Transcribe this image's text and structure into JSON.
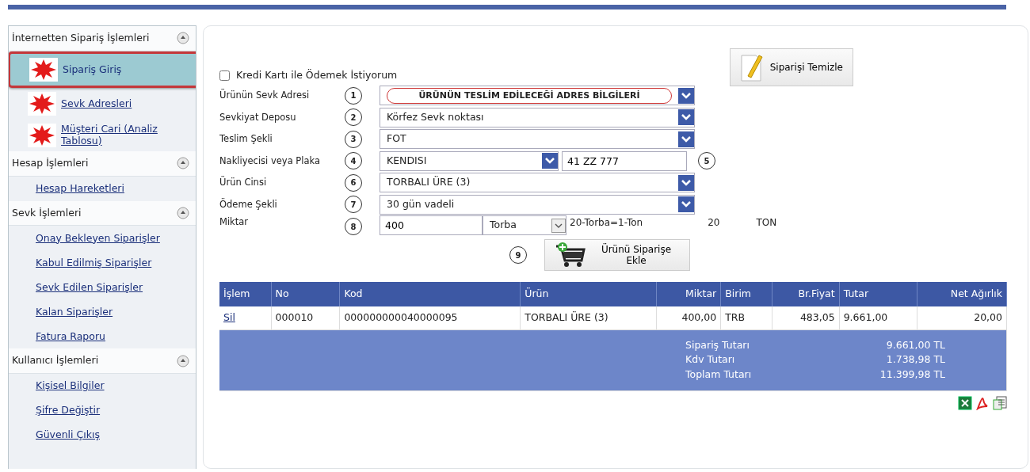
{
  "sidebar": {
    "groups": [
      {
        "title": "İnternetten Sipariş İşlemleri",
        "expanded": true,
        "items": [
          {
            "label": "Sipariş Giriş",
            "new": true,
            "selected": true
          },
          {
            "label": "Sevk Adresleri",
            "new": true,
            "selected": false
          },
          {
            "label": "Müşteri Cari (Analiz Tablosu)",
            "new": true,
            "selected": false
          }
        ]
      },
      {
        "title": "Hesap İşlemleri",
        "expanded": true,
        "items": [
          {
            "label": "Hesap Hareketleri",
            "new": false,
            "selected": false
          }
        ]
      },
      {
        "title": "Sevk İşlemleri",
        "expanded": true,
        "items": [
          {
            "label": "Onay Bekleyen Siparişler",
            "new": false,
            "selected": false
          },
          {
            "label": "Kabul Edilmiş Siparişler",
            "new": false,
            "selected": false
          },
          {
            "label": "Sevk Edilen Siparişler",
            "new": false,
            "selected": false
          },
          {
            "label": "Kalan Siparişler",
            "new": false,
            "selected": false
          },
          {
            "label": "Fatura Raporu",
            "new": false,
            "selected": false
          }
        ]
      },
      {
        "title": "Kullanıcı İşlemleri",
        "expanded": true,
        "items": [
          {
            "label": "Kişisel Bilgiler",
            "new": false,
            "selected": false
          },
          {
            "label": "Şifre Değiştir",
            "new": false,
            "selected": false
          },
          {
            "label": "Güvenli Çıkış",
            "new": false,
            "selected": false
          }
        ]
      }
    ]
  },
  "credit_card": {
    "label": "Kredi Kartı ile Ödemek İstiyorum",
    "checked": false
  },
  "clear_button": "Siparişi Temizle",
  "form_rows": [
    {
      "kind": "select",
      "label": "Ürünün Sevk Adresi",
      "marker": "1",
      "value": "ÜRÜNÜN TESLİM EDİLECEĞİ ADRES BİLGİLERİ",
      "circled": true
    },
    {
      "kind": "select",
      "label": "Sevkiyat Deposu",
      "marker": "2",
      "value": "Körfez Sevk noktası",
      "circled": false
    },
    {
      "kind": "select",
      "label": "Teslim Şekli",
      "marker": "3",
      "value": "FOT",
      "circled": false
    },
    {
      "kind": "select_text",
      "label": "Nakliyecisi veya Plaka",
      "marker": "4",
      "value": "KENDISI",
      "text_value": "41 ZZ 777",
      "marker_2": "5"
    },
    {
      "kind": "select",
      "label": "Ürün Cinsi",
      "marker": "6",
      "value": "TORBALI ÜRE (3)",
      "circled": false
    },
    {
      "kind": "select",
      "label": "Ödeme Şekli",
      "marker": "7",
      "value": "30 gün vadeli",
      "circled": false
    },
    {
      "kind": "quantity",
      "label": "Miktar",
      "marker": "8",
      "value": "400",
      "unit": "Torba",
      "note": "20-Torba=1-Ton",
      "amount": "20",
      "amount_unit": "TON"
    }
  ],
  "add_button": {
    "marker": "9",
    "label": "Ürünü Siparişe Ekle"
  },
  "table": {
    "columns": [
      "İşlem",
      "No",
      "Kod",
      "Ürün",
      "Miktar",
      "Birim",
      "Br.Fiyat",
      "Tutar",
      "Net Ağırlık"
    ],
    "rows": [
      [
        "Sil",
        "000010",
        "000000000040000095",
        "TORBALI ÜRE (3)",
        "400,00",
        "TRB",
        "483,05",
        "9.661,00",
        "20,00"
      ]
    ],
    "summary": [
      {
        "label": "Sipariş Tutarı",
        "value": "9.661,00 TL"
      },
      {
        "label": "Kdv Tutarı",
        "value": "1.738,98 TL"
      },
      {
        "label": "Toplam Tutarı",
        "value": "11.399,98 TL"
      }
    ]
  },
  "exports": [
    {
      "kind": "excel"
    },
    {
      "kind": "pdf"
    },
    {
      "kind": "sheet"
    }
  ]
}
